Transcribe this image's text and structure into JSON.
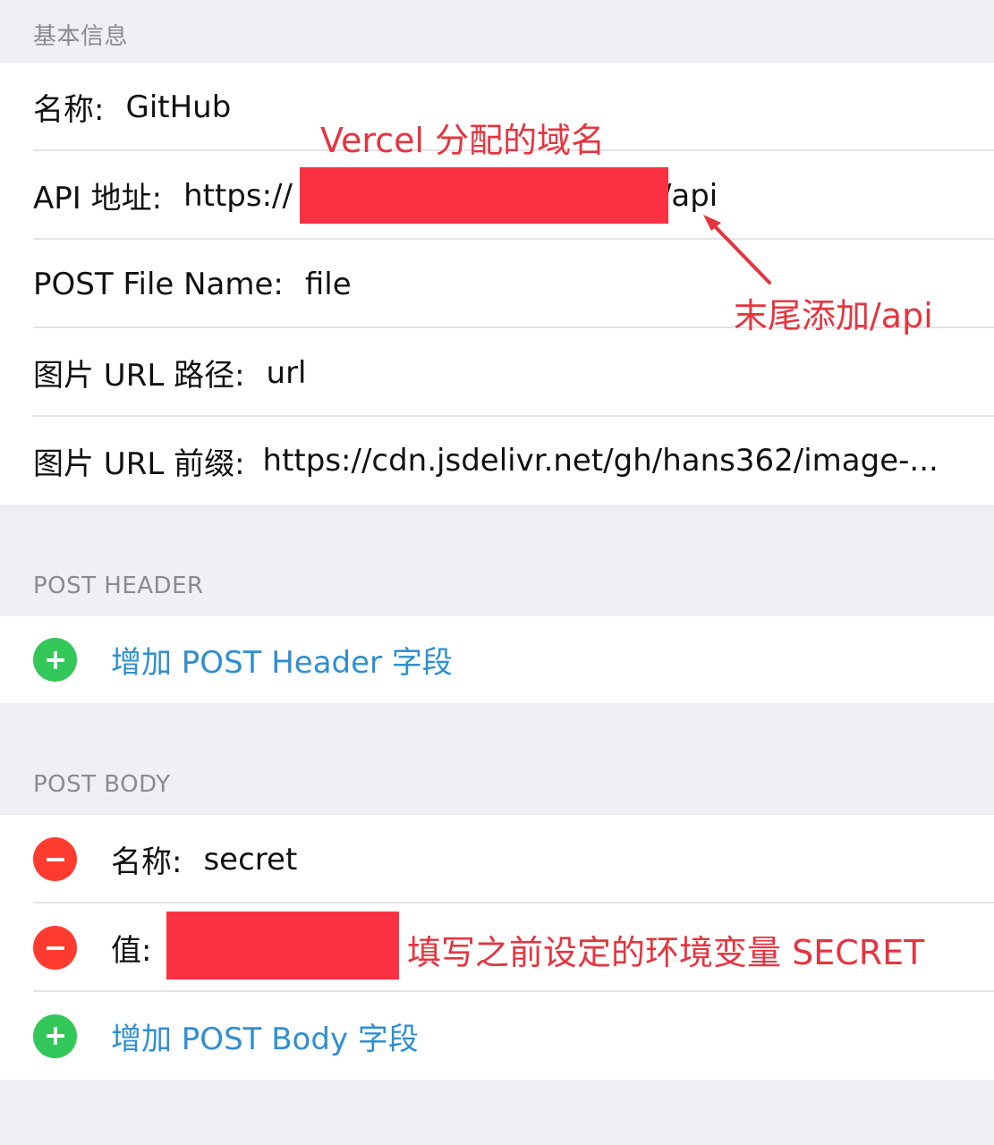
{
  "basic_info": {
    "header": "基本信息",
    "name_label": "名称:",
    "name_value": "GitHub",
    "api_label": "API 地址:",
    "api_prefix": "https://",
    "api_suffix": "/api",
    "post_file_label": "POST File Name:",
    "post_file_value": "file",
    "url_path_label": "图片 URL 路径:",
    "url_path_value": "url",
    "url_prefix_label": "图片 URL 前缀:",
    "url_prefix_value": "https://cdn.jsdelivr.net/gh/hans362/image-..."
  },
  "post_header": {
    "header": "POST HEADER",
    "add_label": "增加 POST Header 字段"
  },
  "post_body": {
    "header": "POST BODY",
    "name_label": "名称:",
    "name_value": "secret",
    "value_label": "值:",
    "add_label": "增加 POST Body 字段"
  },
  "annotations": {
    "vercel_domain": "Vercel 分配的域名",
    "append_api": "末尾添加/api",
    "fill_secret": "填写之前设定的环境变量 SECRET"
  },
  "colors": {
    "add": "#34c759",
    "remove": "#ff3b30",
    "link": "#2f8fd0",
    "annotation": "#e6343f",
    "redaction": "#fb3143"
  },
  "icons": [
    "plus-icon",
    "minus-icon",
    "arrow-icon"
  ]
}
